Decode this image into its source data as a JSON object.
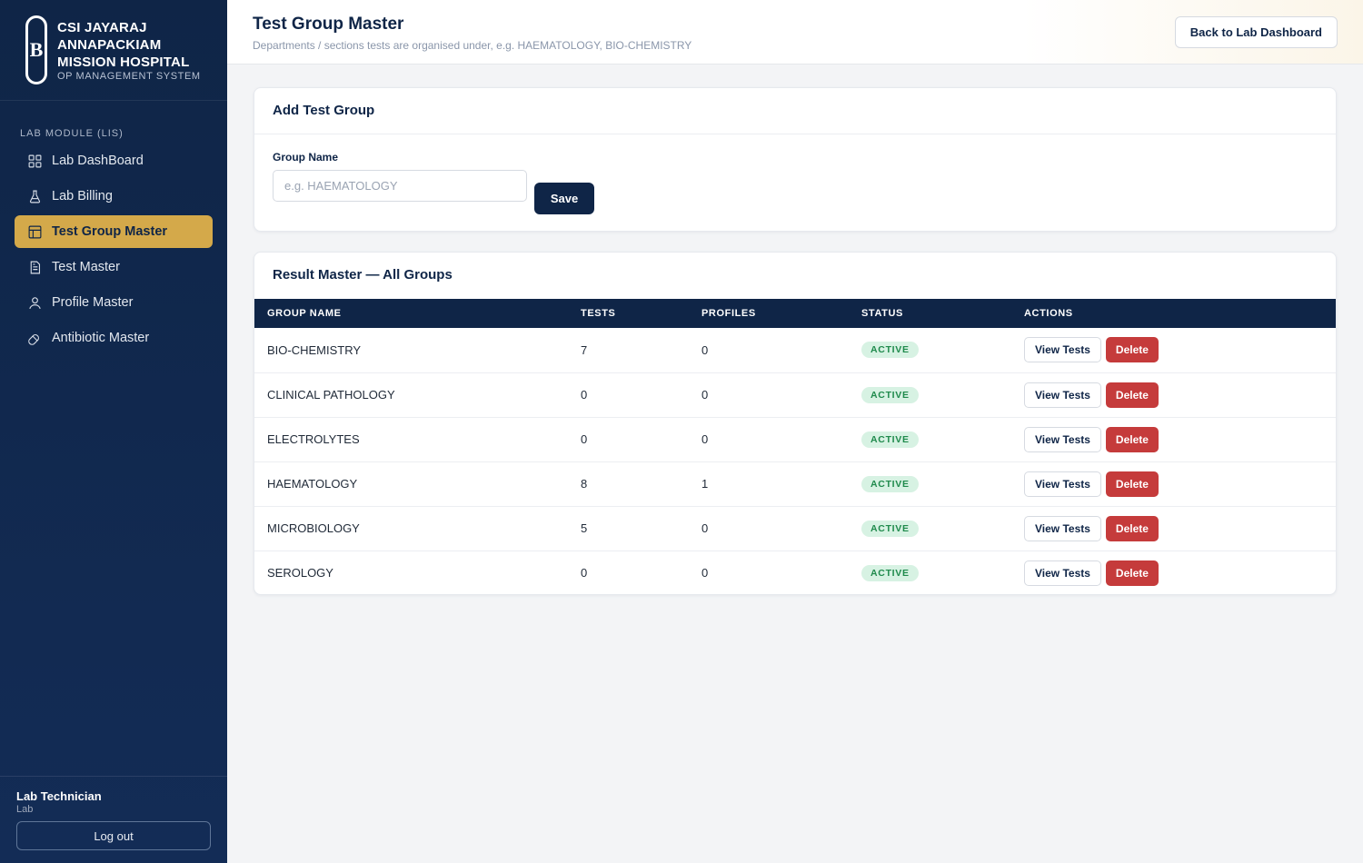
{
  "brand": {
    "logo_letter": "B",
    "name": "CSI JAYARAJ ANNAPACKIAM MISSION HOSPITAL",
    "subtitle": "OP MANAGEMENT SYSTEM"
  },
  "sidebar": {
    "section_label": "LAB MODULE (LIS)",
    "items": [
      {
        "label": "Lab DashBoard",
        "icon": "grid-icon",
        "active": false
      },
      {
        "label": "Lab Billing",
        "icon": "flask-icon",
        "active": false
      },
      {
        "label": "Test Group Master",
        "icon": "layout-icon",
        "active": true
      },
      {
        "label": "Test Master",
        "icon": "document-icon",
        "active": false
      },
      {
        "label": "Profile Master",
        "icon": "user-icon",
        "active": false
      },
      {
        "label": "Antibiotic Master",
        "icon": "pill-icon",
        "active": false
      }
    ],
    "user": {
      "name": "Lab Technician",
      "role": "Lab"
    },
    "logout_label": "Log out"
  },
  "header": {
    "title": "Test Group Master",
    "subtitle": "Departments / sections tests are organised under, e.g. HAEMATOLOGY, BIO-CHEMISTRY",
    "back_label": "Back to Lab Dashboard"
  },
  "add_form": {
    "title": "Add Test Group",
    "field_label": "Group Name",
    "placeholder": "e.g. HAEMATOLOGY",
    "value": "",
    "save_label": "Save"
  },
  "results": {
    "title": "Result Master — All Groups",
    "columns": [
      "GROUP NAME",
      "TESTS",
      "PROFILES",
      "STATUS",
      "ACTIONS"
    ],
    "rows": [
      {
        "name": "BIO-CHEMISTRY",
        "tests": "7",
        "profiles": "0",
        "status": "ACTIVE"
      },
      {
        "name": "CLINICAL PATHOLOGY",
        "tests": "0",
        "profiles": "0",
        "status": "ACTIVE"
      },
      {
        "name": "ELECTROLYTES",
        "tests": "0",
        "profiles": "0",
        "status": "ACTIVE"
      },
      {
        "name": "HAEMATOLOGY",
        "tests": "8",
        "profiles": "1",
        "status": "ACTIVE"
      },
      {
        "name": "MICROBIOLOGY",
        "tests": "5",
        "profiles": "0",
        "status": "ACTIVE"
      },
      {
        "name": "SEROLOGY",
        "tests": "0",
        "profiles": "0",
        "status": "ACTIVE"
      }
    ],
    "view_label": "View Tests",
    "delete_label": "Delete"
  },
  "colors": {
    "navy": "#0f2547",
    "gold": "#d4a94a",
    "danger": "#c53b3b",
    "success_bg": "#d7f2e3",
    "success_text": "#1f8a4c"
  }
}
